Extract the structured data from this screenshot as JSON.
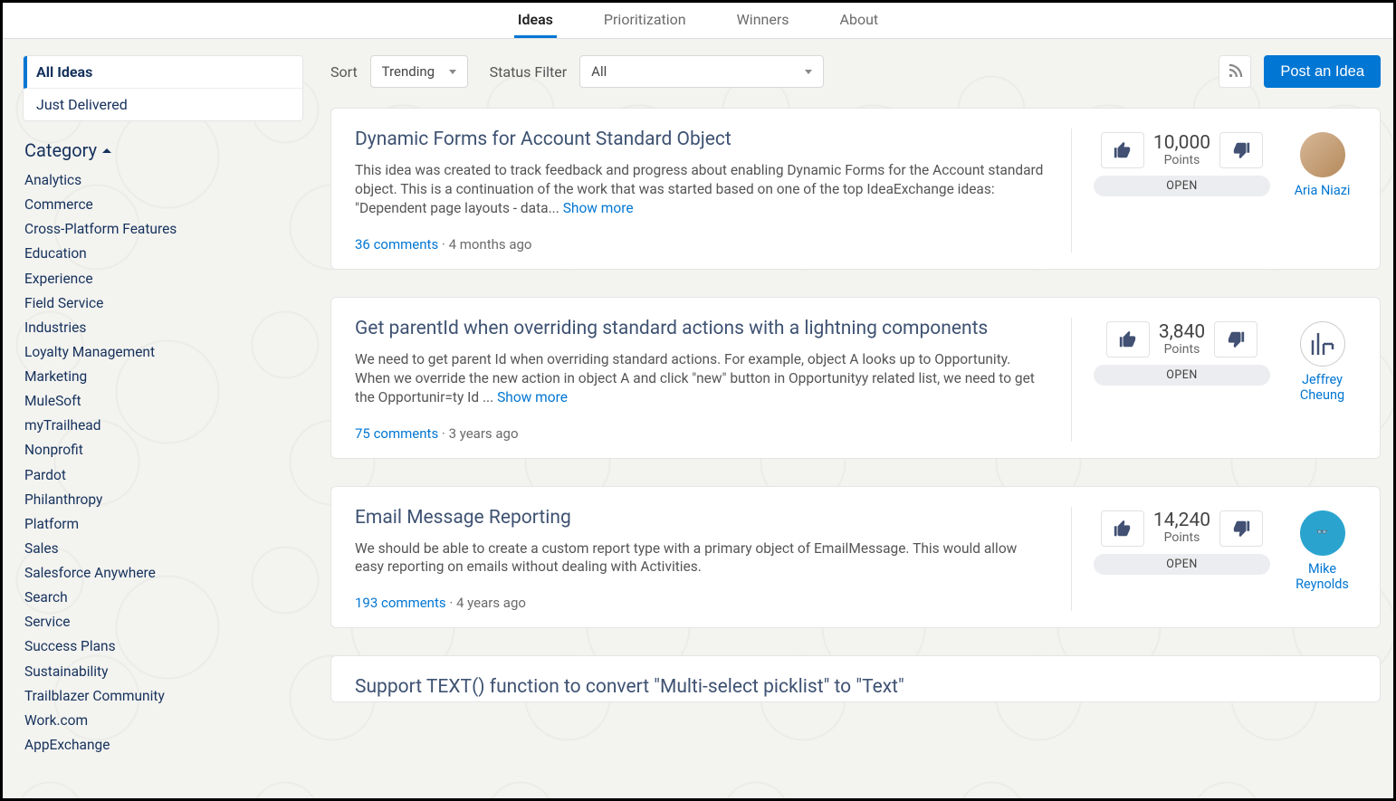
{
  "nav": {
    "tabs": [
      {
        "label": "Ideas",
        "active": true
      },
      {
        "label": "Prioritization",
        "active": false
      },
      {
        "label": "Winners",
        "active": false
      },
      {
        "label": "About",
        "active": false
      }
    ]
  },
  "sidebar": {
    "top": [
      {
        "label": "All Ideas",
        "active": true
      },
      {
        "label": "Just Delivered",
        "active": false
      }
    ],
    "category_header": "Category",
    "categories": [
      "Analytics",
      "Commerce",
      "Cross-Platform Features",
      "Education",
      "Experience",
      "Field Service",
      "Industries",
      "Loyalty Management",
      "Marketing",
      "MuleSoft",
      "myTrailhead",
      "Nonprofit",
      "Pardot",
      "Philanthropy",
      "Platform",
      "Sales",
      "Salesforce Anywhere",
      "Search",
      "Service",
      "Success Plans",
      "Sustainability",
      "Trailblazer Community",
      "Work.com",
      "AppExchange"
    ]
  },
  "controls": {
    "sort_label": "Sort",
    "sort_value": "Trending",
    "filter_label": "Status Filter",
    "filter_value": "All",
    "post_label": "Post an Idea"
  },
  "ideas": [
    {
      "title": "Dynamic Forms for Account Standard Object",
      "body": "This idea was created to track feedback and progress about enabling Dynamic Forms for the Account standard object. This is a continuation of the work that was started based on one of the top IdeaExchange ideas: \"Dependent page layouts - data... ",
      "show_more": "Show more",
      "comments": "36 comments",
      "age": "4 months ago",
      "points": "10,000",
      "points_label": "Points",
      "status": "OPEN",
      "author": "Aria Niazi",
      "avatar_kind": "photo"
    },
    {
      "title": "Get parentId when overriding standard actions with a lightning components",
      "body": "We need to get parent Id when overriding standard actions. For example, object A looks up to Opportunity. When we override the new action in object A and click \"new\" button in Opportunityy related list, we need to get the Opportunir=ty Id ... ",
      "show_more": "Show more",
      "comments": "75 comments",
      "age": "3 years ago",
      "points": "3,840",
      "points_label": "Points",
      "status": "OPEN",
      "author": "Jeffrey Cheung",
      "avatar_kind": "logo"
    },
    {
      "title": "Email Message Reporting",
      "body": "We should be able to create a custom report type with a primary object of EmailMessage. This would allow easy reporting on emails without dealing with Activities.",
      "show_more": "",
      "comments": "193 comments",
      "age": "4 years ago",
      "points": "14,240",
      "points_label": "Points",
      "status": "OPEN",
      "author": "Mike Reynolds",
      "avatar_kind": "teal"
    },
    {
      "title": "Support TEXT() function to convert \"Multi-select picklist\" to \"Text\"",
      "body": "",
      "show_more": "",
      "comments": "",
      "age": "",
      "points": "",
      "points_label": "",
      "status": "",
      "author": "",
      "avatar_kind": ""
    }
  ]
}
